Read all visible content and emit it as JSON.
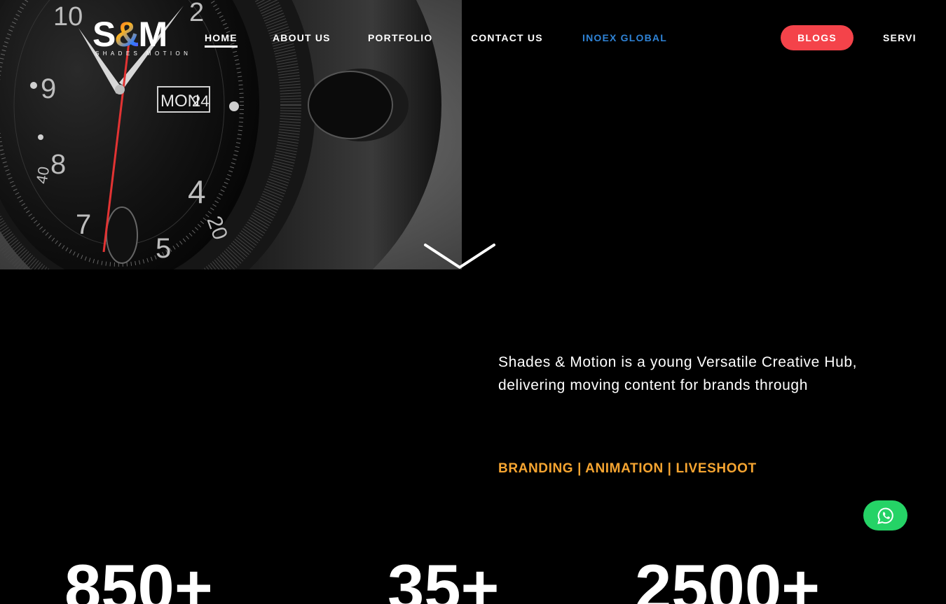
{
  "brand": {
    "logo_text_left": "S",
    "logo_text_amp": "&",
    "logo_text_right": "M",
    "tagline": "SHADES MOTION"
  },
  "nav": {
    "items": [
      {
        "label": "HOME",
        "active": true
      },
      {
        "label": "ABOUT US"
      },
      {
        "label": "PORTFOLIO"
      },
      {
        "label": "CONTACT US"
      },
      {
        "label": "INOEX GLOBAL",
        "color": "#2f83d6"
      },
      {
        "label": "BLOGS",
        "style": "pill",
        "color": "#f4434a"
      },
      {
        "label": "SERVI"
      }
    ]
  },
  "hero": {
    "watch_date_label": "MON",
    "watch_date_number": "24",
    "dial_numbers": [
      "10",
      "9",
      "8",
      "7",
      "5",
      "4",
      "2",
      "20",
      "40"
    ]
  },
  "intro": {
    "line1": "Shades & Motion  is a young Versatile Creative Hub,",
    "line2": "delivering moving content for brands through",
    "services": "BRANDING | ANIMATION | LIVESHOOT",
    "services_color": "#f6a531"
  },
  "stats": [
    "850+",
    "35+",
    "2500+"
  ],
  "icons": {
    "scroll": "chevron-down-icon",
    "whatsapp": "whatsapp-icon"
  },
  "colors": {
    "background": "#000000",
    "accent_red": "#f4434a",
    "accent_blue": "#2f83d6",
    "accent_orange": "#f6a531",
    "whatsapp_green": "#25d366"
  }
}
